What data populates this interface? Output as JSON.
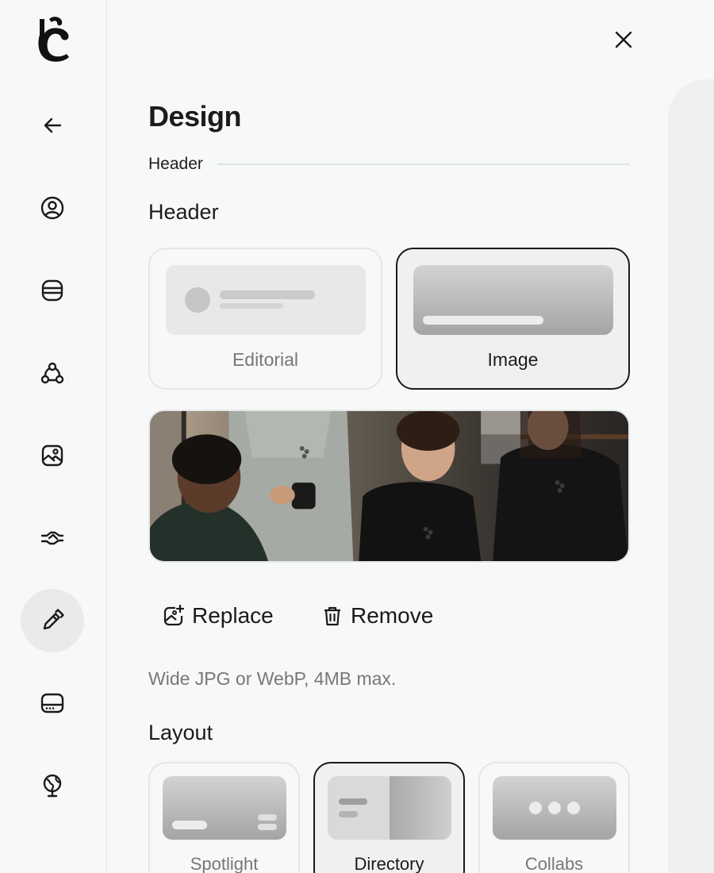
{
  "page": {
    "title": "Design",
    "breadcrumb": "Header"
  },
  "sidebar": {
    "items": [
      {
        "name": "back",
        "icon": "arrow-left-icon"
      },
      {
        "name": "profile",
        "icon": "user-circle-icon"
      },
      {
        "name": "database",
        "icon": "database-icon"
      },
      {
        "name": "connections",
        "icon": "share-nodes-icon"
      },
      {
        "name": "media",
        "icon": "image-icon"
      },
      {
        "name": "integrations",
        "icon": "handshake-icon"
      },
      {
        "name": "design",
        "icon": "pen-icon",
        "active": true
      },
      {
        "name": "device",
        "icon": "tablet-icon"
      },
      {
        "name": "language",
        "icon": "globe-icon"
      }
    ]
  },
  "header_section": {
    "title": "Header",
    "options": [
      {
        "label": "Editorial",
        "selected": false
      },
      {
        "label": "Image",
        "selected": true
      }
    ]
  },
  "image_actions": {
    "replace_label": "Replace",
    "remove_label": "Remove"
  },
  "hint": "Wide JPG or WebP, 4MB max.",
  "layout_section": {
    "title": "Layout",
    "options": [
      {
        "label": "Spotlight",
        "selected": false
      },
      {
        "label": "Directory",
        "selected": true
      },
      {
        "label": "Collabs",
        "selected": false
      }
    ]
  },
  "colors": {
    "accent": "#1a1a1a",
    "background": "#f7f8f8",
    "active_nav": "#e9eaea"
  }
}
